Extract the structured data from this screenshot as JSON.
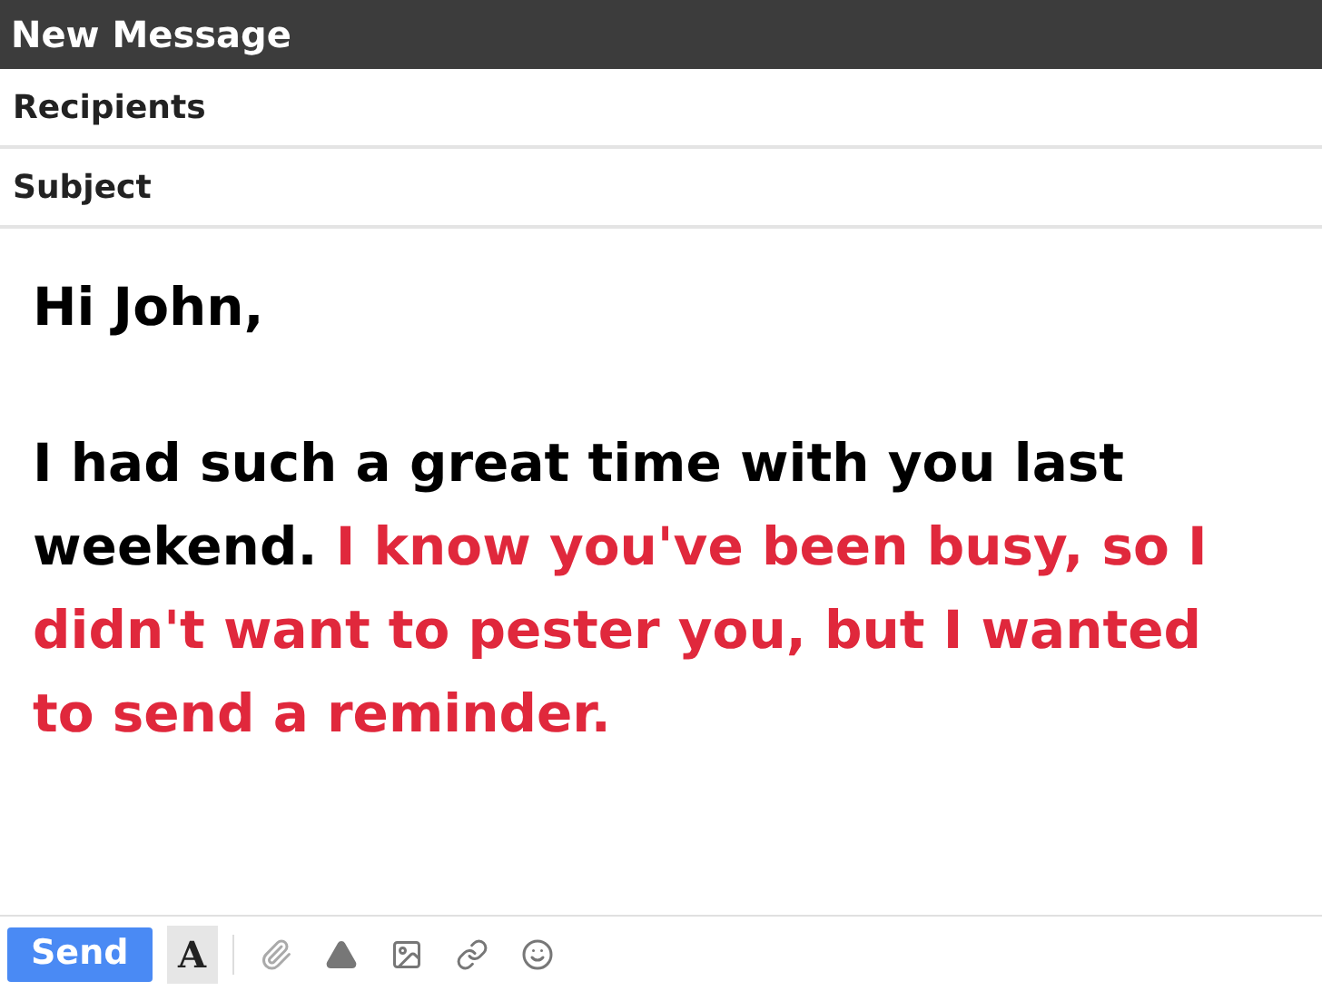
{
  "window": {
    "title": "New Message"
  },
  "fields": [
    {
      "placeholder": "Recipients"
    },
    {
      "placeholder": "Subject"
    }
  ],
  "body": [
    [
      {
        "text": "Hi John,",
        "highlight": false
      }
    ],
    [
      {
        "text": "I had such a great time with you last weekend. ",
        "highlight": false
      },
      {
        "text": "I know you've been busy, so I didn't want to pester you, but I wanted to send a reminder.",
        "highlight": true
      }
    ]
  ],
  "toolbar": {
    "send": "Send",
    "format": "A",
    "format_selected": true
  }
}
